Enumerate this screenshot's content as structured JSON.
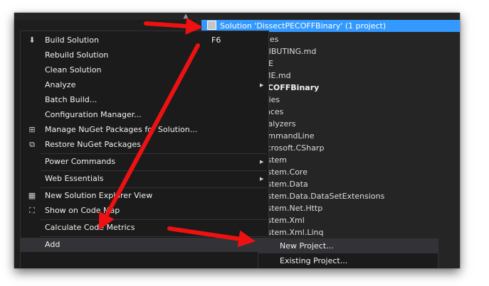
{
  "solution_explorer": {
    "solution_label": "Solution 'DissectPECOFFBinary' (1 project)",
    "rows": [
      "o Files",
      "NTRIBUTING.md",
      "ENSE",
      "ADME.md",
      "tPECOFFBinary",
      "perties",
      "erences",
      "Analyzers",
      "CommandLine",
      "Microsoft.CSharp",
      "System",
      "System.Core",
      "System.Data",
      "System.Data.DataSetExtensions",
      "System.Net.Http",
      "System.Xml",
      "System.Xml.Linq"
    ]
  },
  "context_menu": {
    "items": [
      {
        "label": "Build Solution",
        "shortcut": "F6"
      },
      {
        "label": "Rebuild Solution"
      },
      {
        "label": "Clean Solution"
      },
      {
        "label": "Analyze"
      },
      {
        "label": "Batch Build..."
      },
      {
        "label": "Configuration Manager..."
      },
      {
        "label": "Manage NuGet Packages for Solution..."
      },
      {
        "label": "Restore NuGet Packages"
      },
      {
        "label": "Power Commands"
      },
      {
        "label": "Web Essentials"
      },
      {
        "label": "New Solution Explorer View"
      },
      {
        "label": "Show on Code Map"
      },
      {
        "label": "Calculate Code Metrics"
      },
      {
        "label": "Add"
      }
    ]
  },
  "add_submenu": {
    "items": [
      {
        "label": "New Project..."
      },
      {
        "label": "Existing Project..."
      }
    ]
  },
  "icons": {
    "build": "build-icon",
    "nuget": "nuget-icon",
    "restore": "restore-packages-icon",
    "explorer_view": "solution-explorer-view-icon",
    "code_map": "code-map-icon",
    "submenu_arrow": "chevron-right-icon",
    "solution": "solution-icon"
  },
  "colors": {
    "selection": "#3399ff",
    "menu_bg": "#1b1b1c",
    "highlight": "#333337",
    "annotation_arrow": "#ee1111"
  }
}
